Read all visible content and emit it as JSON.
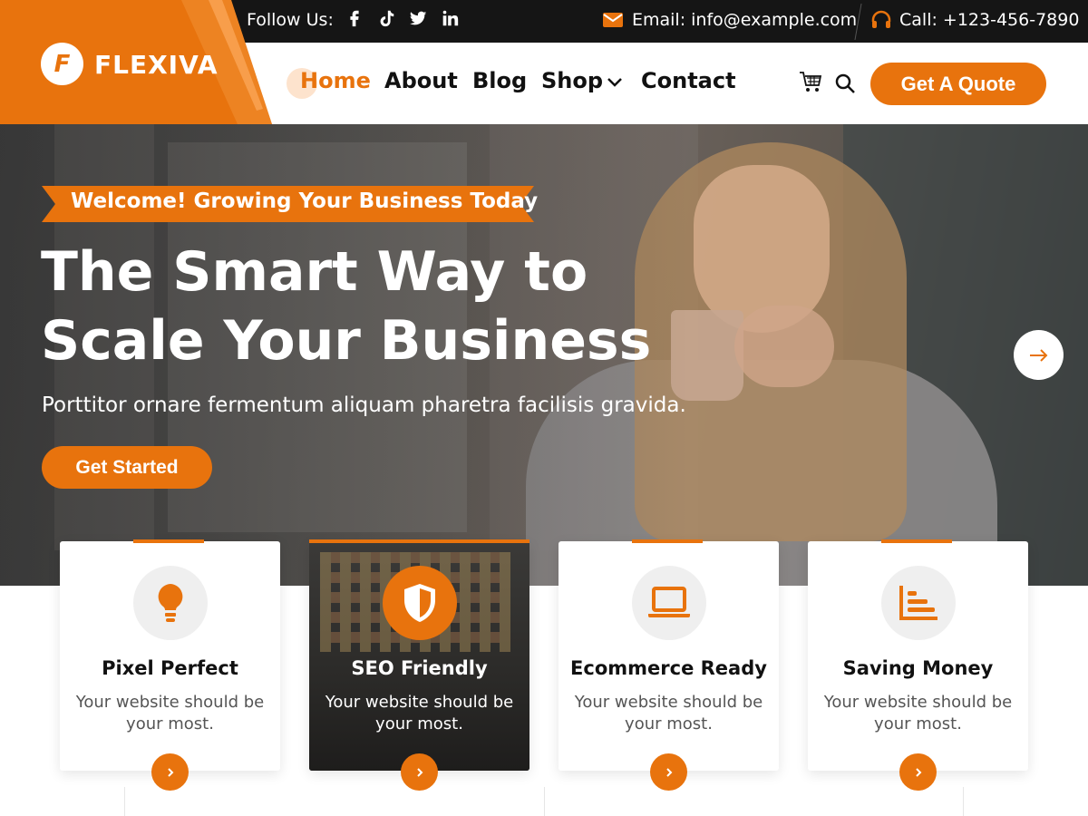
{
  "brand": {
    "name": "FLEXIVA",
    "accent": "#e8730d",
    "dark": "#151515"
  },
  "topbar": {
    "follow_label": "Follow Us:",
    "social_icons": [
      "facebook-icon",
      "tiktok-icon",
      "twitter-icon",
      "linkedin-icon"
    ],
    "email": "Email: info@example.com",
    "call": "Call: +123-456-7890"
  },
  "nav": {
    "items": [
      "Home",
      "About",
      "Blog",
      "Shop",
      "Contact"
    ],
    "active": "Home",
    "quote_button": "Get A Quote"
  },
  "hero": {
    "ribbon": "Welcome! Growing Your Business Today",
    "title_line1": "The Smart Way to",
    "title_line2": "Scale Your Business",
    "subtitle": "Porttitor ornare fermentum aliquam pharetra facilisis gravida.",
    "cta": "Get Started"
  },
  "features": [
    {
      "title": "Pixel Perfect",
      "desc": "Your website should be your most.",
      "icon": "lightbulb-icon"
    },
    {
      "title": "SEO Friendly",
      "desc": "Your website should be your most.",
      "icon": "shield-icon"
    },
    {
      "title": "Ecommerce Ready",
      "desc": "Your website should be your most.",
      "icon": "laptop-icon"
    },
    {
      "title": "Saving Money",
      "desc": "Your website should be your most.",
      "icon": "chart-bars-icon"
    }
  ]
}
